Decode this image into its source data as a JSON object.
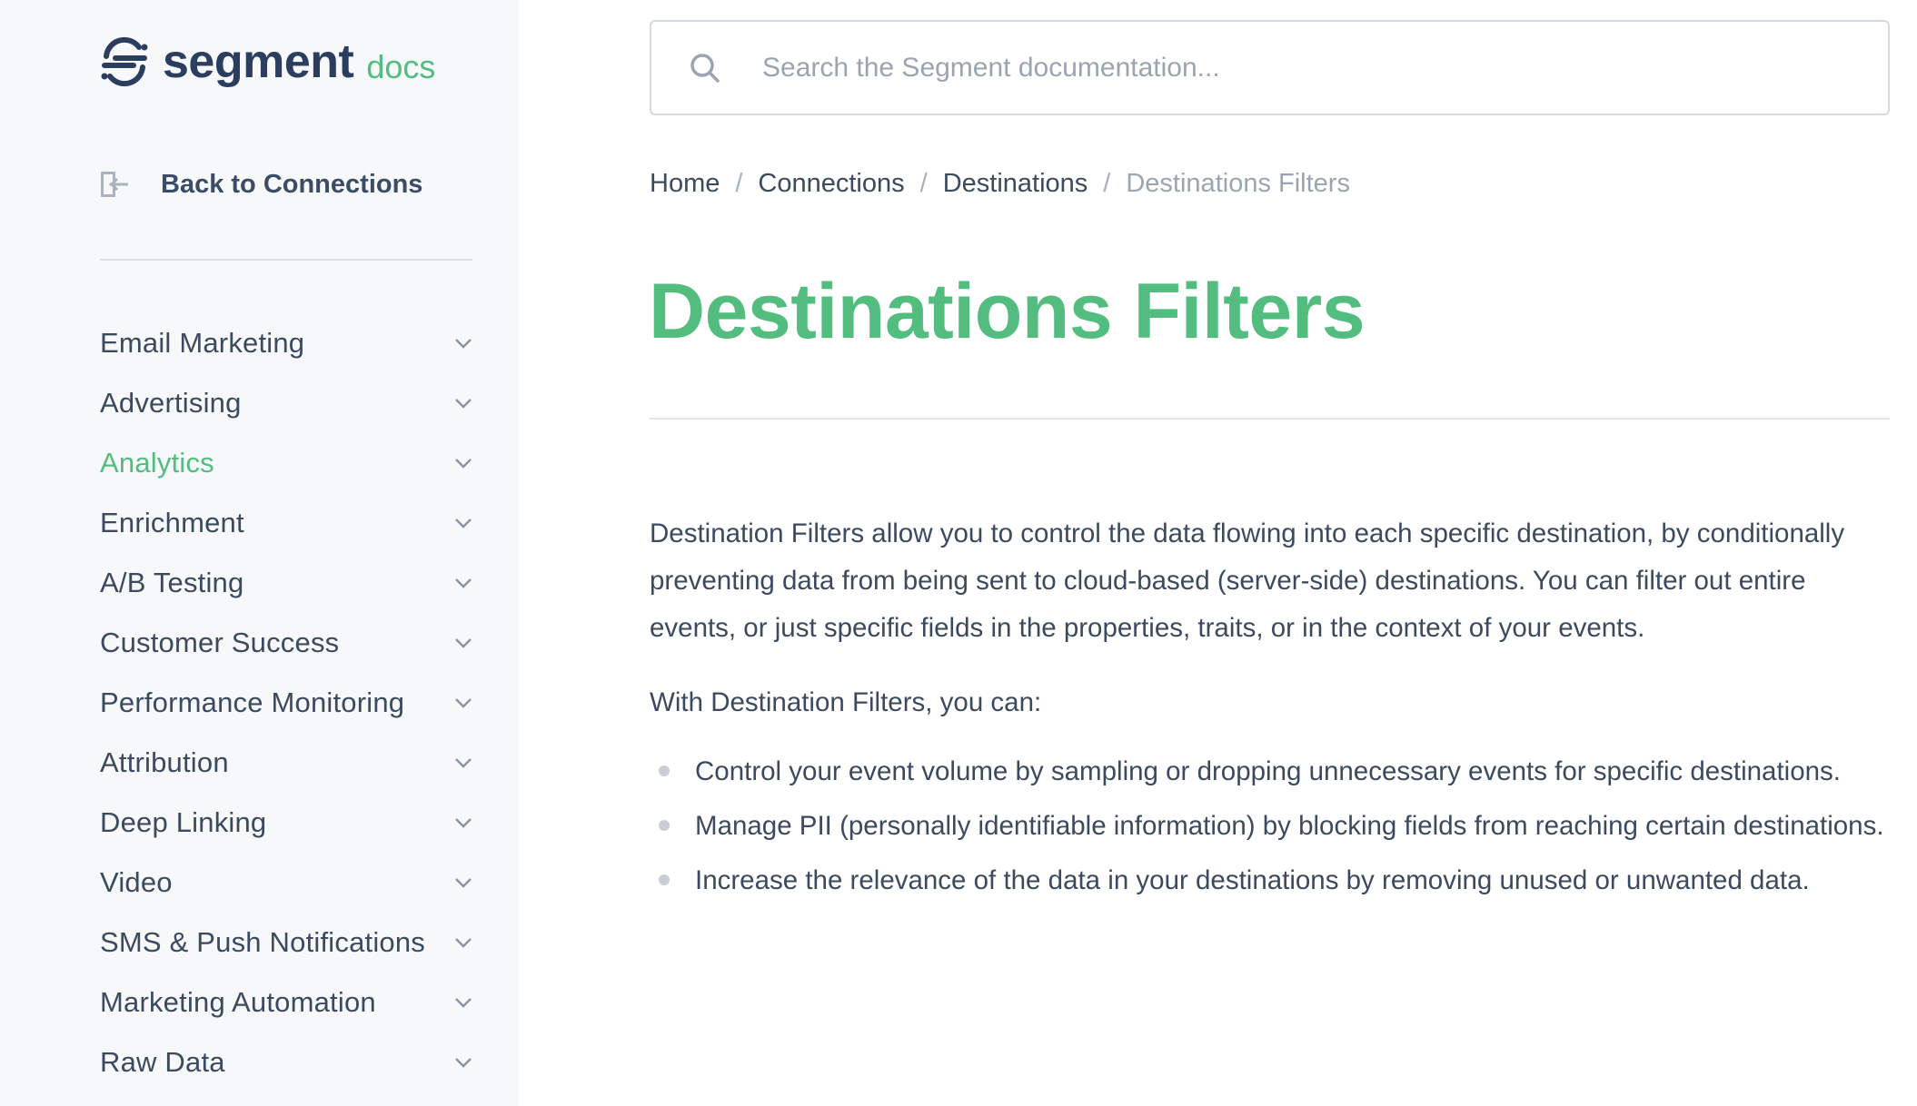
{
  "brand": {
    "name": "segment",
    "suffix": "docs",
    "colors": {
      "accent": "#52bd7f",
      "navy": "#2b3e5f"
    }
  },
  "sidebar": {
    "back_label": "Back to Connections",
    "items": [
      {
        "label": "Email Marketing",
        "active": false
      },
      {
        "label": "Advertising",
        "active": false
      },
      {
        "label": "Analytics",
        "active": true
      },
      {
        "label": "Enrichment",
        "active": false
      },
      {
        "label": "A/B Testing",
        "active": false
      },
      {
        "label": "Customer Success",
        "active": false
      },
      {
        "label": "Performance Monitoring",
        "active": false
      },
      {
        "label": "Attribution",
        "active": false
      },
      {
        "label": "Deep Linking",
        "active": false
      },
      {
        "label": "Video",
        "active": false
      },
      {
        "label": "SMS & Push Notifications",
        "active": false
      },
      {
        "label": "Marketing Automation",
        "active": false
      },
      {
        "label": "Raw Data",
        "active": false
      }
    ]
  },
  "search": {
    "placeholder": "Search the Segment documentation...",
    "value": ""
  },
  "breadcrumb": {
    "items": [
      "Home",
      "Connections",
      "Destinations"
    ],
    "current": "Destinations Filters",
    "separator": "/"
  },
  "page": {
    "title": "Destinations Filters",
    "intro": "Destination Filters allow you to control the data flowing into each specific destination, by conditionally preventing data from being sent to cloud-based (server-side) destinations. You can filter out entire events, or just specific fields in the properties, traits, or in the context of your events.",
    "lead_in": "With Destination Filters, you can:",
    "bullets": [
      "Control your event volume by sampling or dropping unnecessary events for specific destinations.",
      "Manage PII (personally identifiable information) by blocking fields from reaching certain destinations.",
      "Increase the relevance of the data in your destinations by removing unused or unwanted data."
    ]
  }
}
